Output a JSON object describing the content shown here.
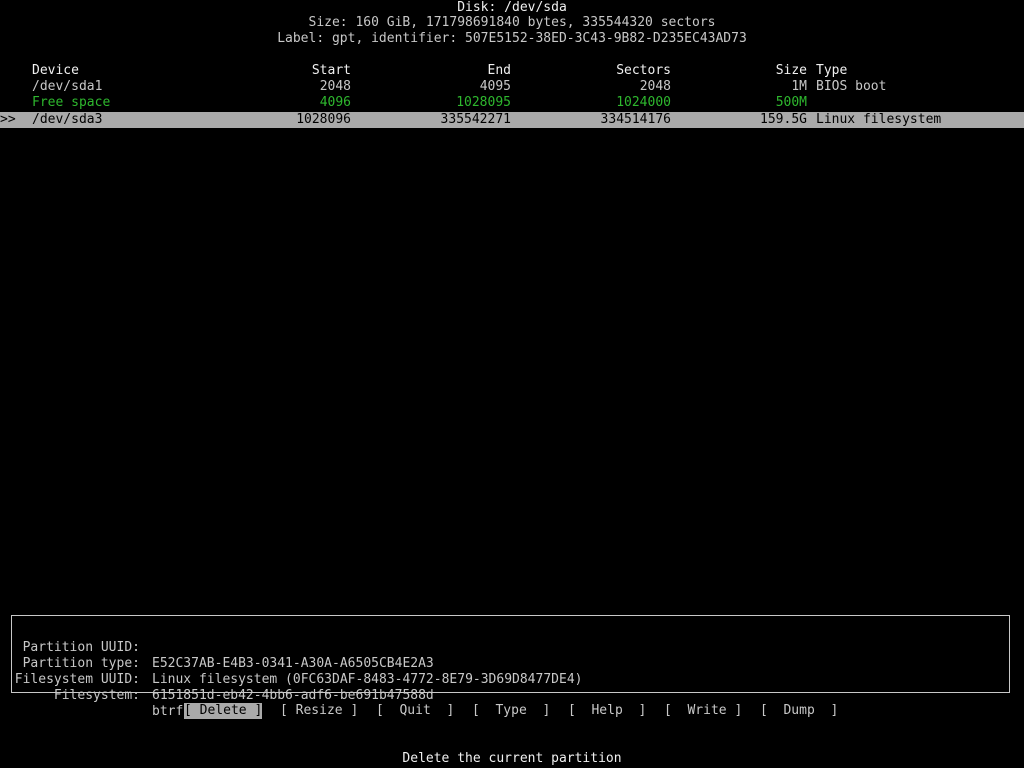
{
  "disk": {
    "title": "Disk: /dev/sda",
    "size_line": "Size: 160 GiB, 171798691840 bytes, 335544320 sectors",
    "label_line": "Label: gpt, identifier: 507E5152-38ED-3C43-9B82-D235EC43AD73"
  },
  "table": {
    "headers": {
      "device": "Device",
      "start": "Start",
      "end": "End",
      "sectors": "Sectors",
      "size": "Size",
      "type": "Type"
    },
    "rows": [
      {
        "pointer": "",
        "device": "/dev/sda1",
        "start": "2048",
        "end": "4095",
        "sectors": "2048",
        "size": "1M",
        "type": "BIOS boot"
      },
      {
        "pointer": "",
        "device": "Free space",
        "start": "4096",
        "end": "1028095",
        "sectors": "1024000",
        "size": "500M",
        "type": ""
      },
      {
        "pointer": ">>",
        "device": "/dev/sda3",
        "start": "1028096",
        "end": "335542271",
        "sectors": "334514176",
        "size": "159.5G",
        "type": "Linux filesystem"
      }
    ],
    "free_space_color": "#2eb82e",
    "selected_bg": "#aaaaaa"
  },
  "info": {
    "partition_uuid": {
      "key": "Partition UUID:",
      "value": "E52C37AB-E4B3-0341-A30A-A6505CB4E2A3"
    },
    "partition_type": {
      "key": "Partition type:",
      "value": "Linux filesystem (0FC63DAF-8483-4772-8E79-3D69D8477DE4)"
    },
    "filesystem_uuid": {
      "key": "Filesystem UUID:",
      "value": "6151851d-eb42-4bb6-adf6-be691b47588d"
    },
    "filesystem": {
      "key": "Filesystem:",
      "value": "btrfs"
    }
  },
  "menu": {
    "delete": "[ Delete ]",
    "resize": "[ Resize ]",
    "quit": "[  Quit  ]",
    "type": "[  Type  ]",
    "help": "[  Help  ]",
    "write": "[  Write ]",
    "dump": "[  Dump  ]",
    "selected": "delete"
  },
  "status": "Delete the current partition"
}
